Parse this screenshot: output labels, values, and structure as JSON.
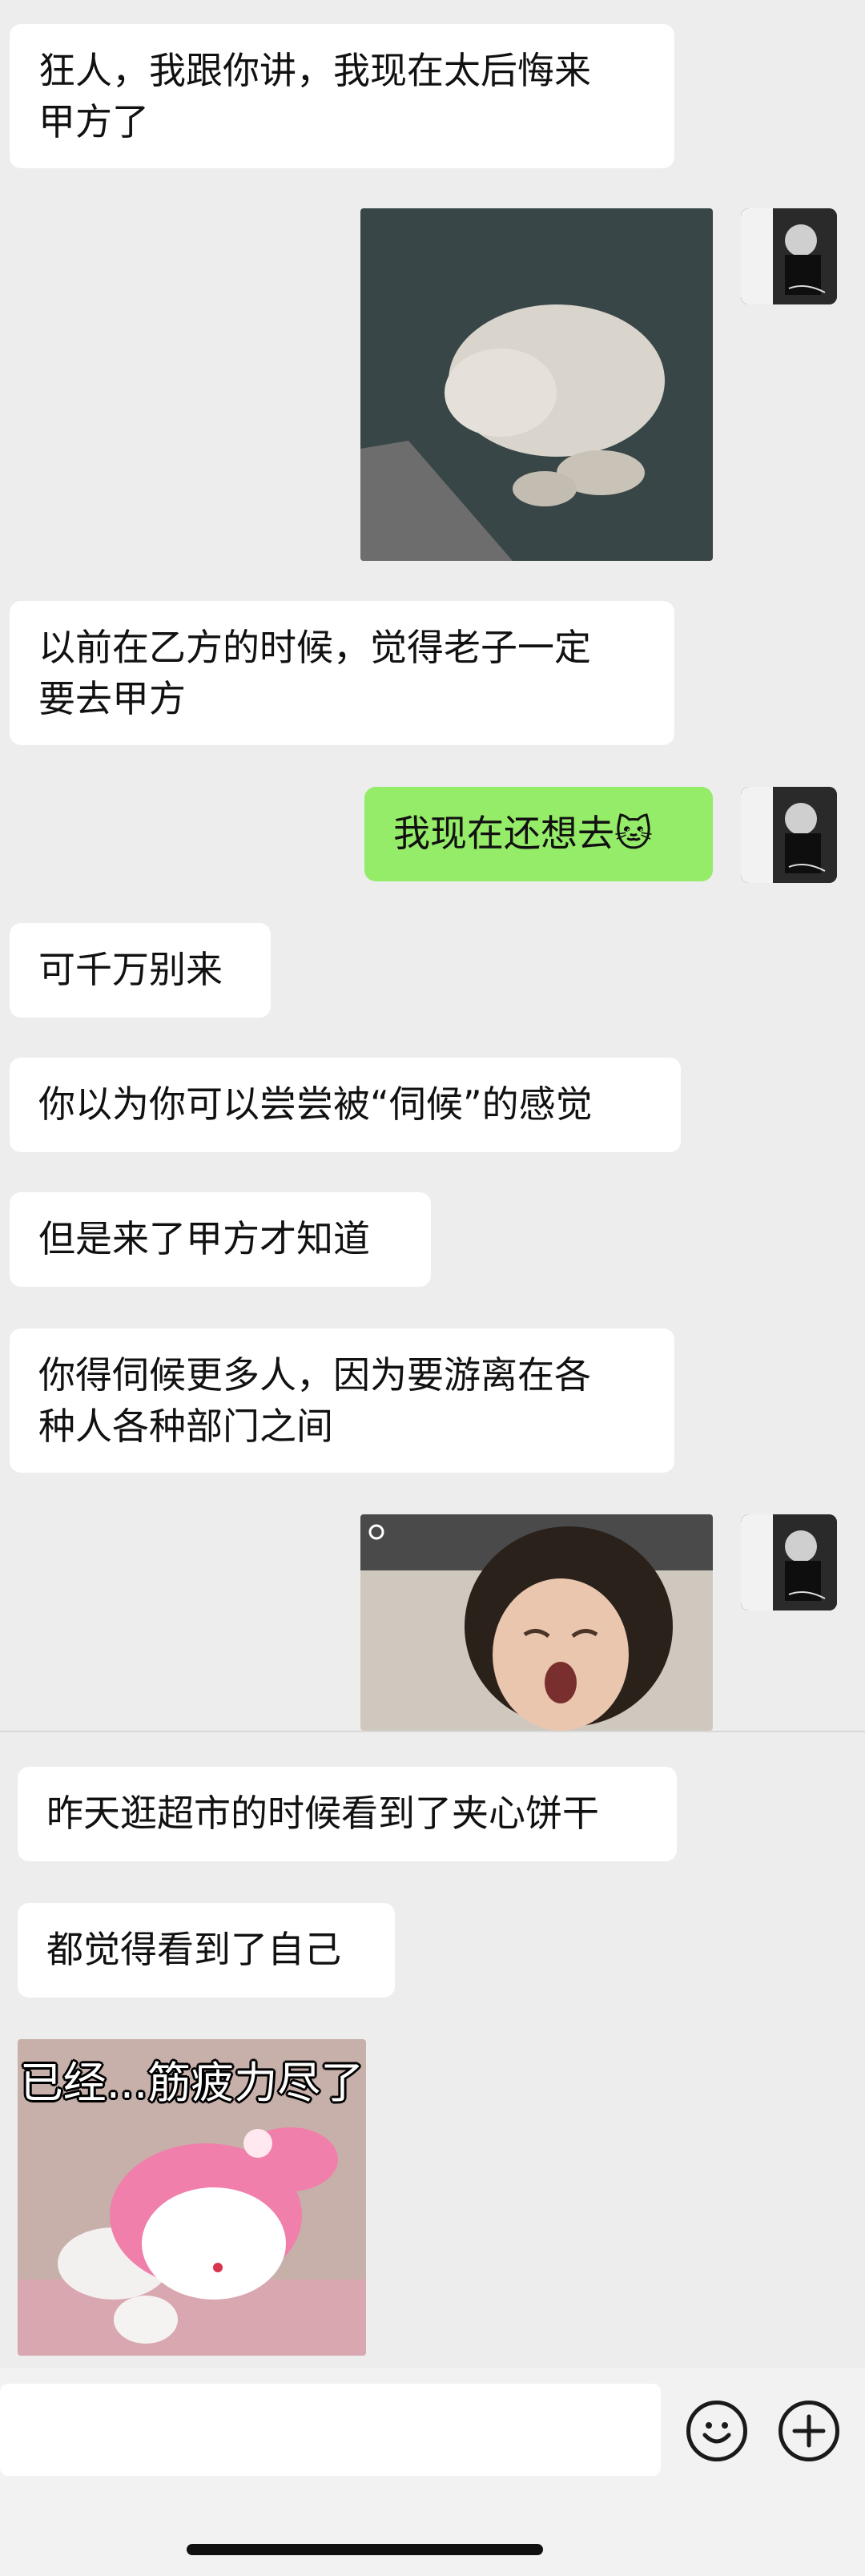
{
  "chat": {
    "messages": [
      {
        "text": "狂人，我跟你讲，我现在太后悔来\n甲方了"
      },
      {
        "text": "以前在乙方的时候，觉得老子一定\n要去甲方"
      },
      {
        "text": "我现在还想去🐱"
      },
      {
        "text": "可千万别来"
      },
      {
        "text": "你以为你可以尝尝被“伺候”的感觉"
      },
      {
        "text": "但是来了甲方才知道"
      },
      {
        "text": "你得伺候更多人，因为要游离在各\n种人各种部门之间"
      },
      {
        "text": "昨天逛超市的时候看到了夹心饼干"
      },
      {
        "text": "都觉得看到了自己"
      }
    ],
    "sticker_caption": "已经...筋疲力尽了"
  },
  "colors": {
    "background": "#ededed",
    "left_bubble": "#ffffff",
    "right_bubble": "#95ec69"
  },
  "icons": {
    "emoji_button": "smiley-face-icon",
    "add_button": "plus-icon"
  }
}
